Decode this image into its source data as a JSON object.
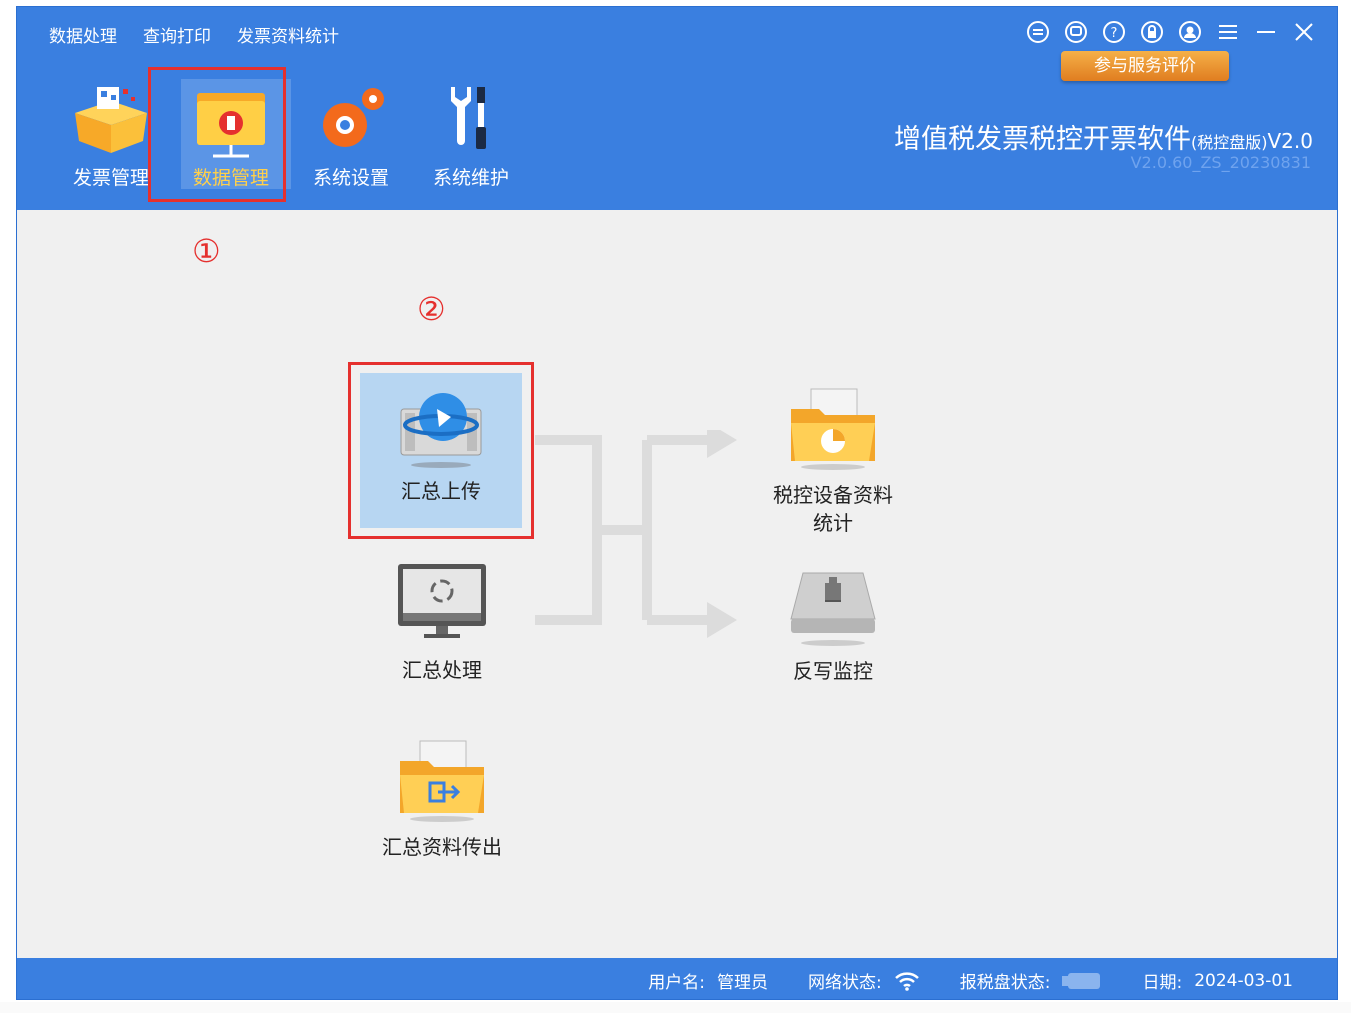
{
  "menu": [
    "数据处理",
    "查询打印",
    "发票资料统计"
  ],
  "toolbar": [
    {
      "label": "发票管理",
      "icon": "box-icon"
    },
    {
      "label": "数据管理",
      "icon": "folder-data-icon",
      "active": true
    },
    {
      "label": "系统设置",
      "icon": "gear-icon"
    },
    {
      "label": "系统维护",
      "icon": "wrench-icon"
    }
  ],
  "window_icons": [
    "minus-circle-icon",
    "chat-icon",
    "help-icon",
    "lock-icon",
    "user-icon",
    "menu-icon",
    "minimize-icon",
    "close-icon"
  ],
  "rate_button": "参与服务评价",
  "app": {
    "title": "增值税发票税控开票软件",
    "edition": "(税控盘版)",
    "version_short": "V2.0",
    "version_full": "V2.0.60_ZS_20230831"
  },
  "annotations": {
    "step1": "①",
    "step2": "②"
  },
  "items": {
    "upload": "汇总上传",
    "process": "汇总处理",
    "export": "汇总资料传出",
    "stats_line1": "税控设备资料",
    "stats_line2": "统计",
    "writeback": "反写监控"
  },
  "status": {
    "user_label": "用户名:",
    "user_value": "管理员",
    "network_label": "网络状态:",
    "disk_label": "报税盘状态:",
    "date_label": "日期:",
    "date_value": "2024-03-01"
  },
  "colors": {
    "header": "#3a7fe0",
    "highlight": "#e5302e",
    "selected": "#b7d6f2",
    "accent": "#ffd04a"
  }
}
